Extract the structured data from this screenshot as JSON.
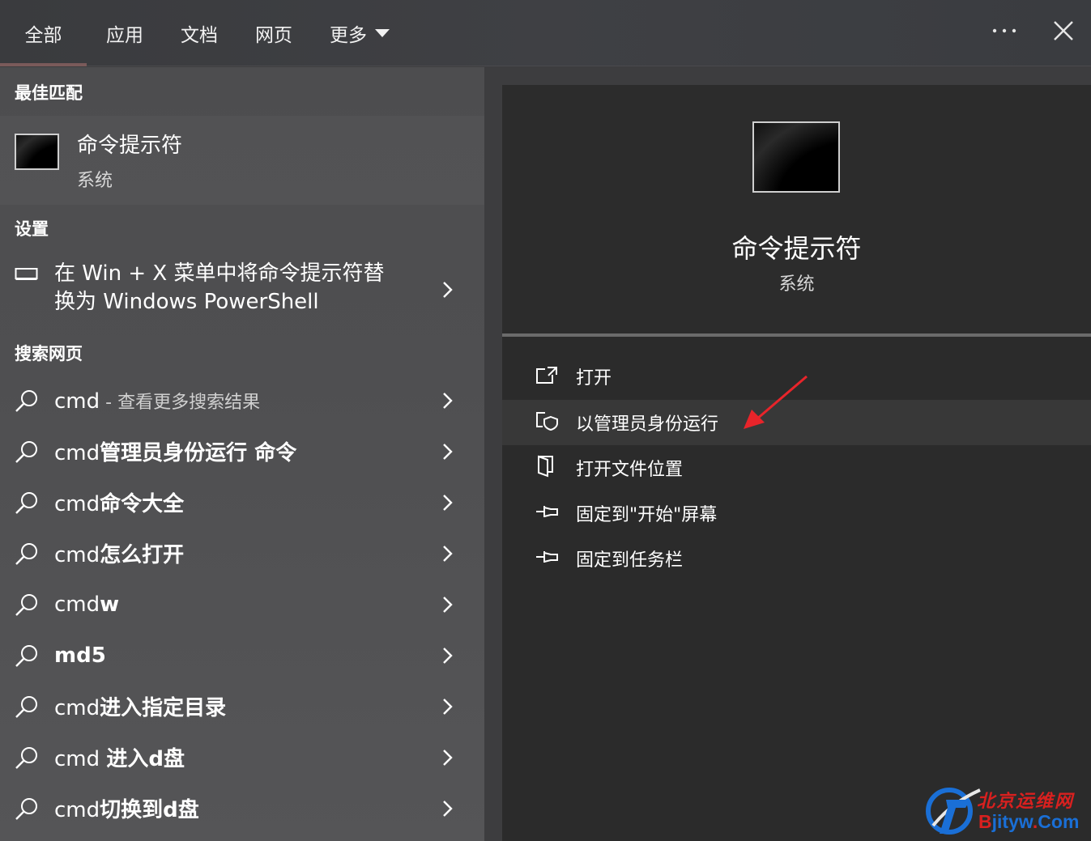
{
  "tabs": [
    {
      "label": "全部",
      "active": true
    },
    {
      "label": "应用"
    },
    {
      "label": "文档"
    },
    {
      "label": "网页"
    },
    {
      "label": "更多"
    }
  ],
  "top_icons": {
    "more": "more-horizontal-icon",
    "close": "close-icon"
  },
  "left": {
    "best_match_title": "最佳匹配",
    "best_match": {
      "name": "命令提示符",
      "subtitle": "系统",
      "icon": "command-prompt-icon"
    },
    "settings_title": "设置",
    "setting_item": {
      "line1": "在 Win + X 菜单中将命令提示符替",
      "line2": "换为 Windows PowerShell",
      "icon": "display-icon"
    },
    "web_title": "搜索网页",
    "web_items": [
      {
        "prefix": "cmd",
        "suffix": " - 查看更多搜索结果",
        "style": "muted"
      },
      {
        "prefix": "cmd",
        "suffix": "管理员身份运行 命令",
        "style": "bold"
      },
      {
        "prefix": "cmd",
        "suffix": "命令大全",
        "style": "bold"
      },
      {
        "prefix": "cmd",
        "suffix": "怎么打开",
        "style": "bold"
      },
      {
        "prefix": "cmd",
        "suffix": "w",
        "style": "bold"
      },
      {
        "prefix": "",
        "suffix": "md5",
        "style": "bold"
      },
      {
        "prefix": "cmd",
        "suffix": "进入指定目录",
        "style": "bold"
      },
      {
        "prefix": "cmd ",
        "suffix": "进入d盘",
        "style": "bold"
      },
      {
        "prefix": "cmd",
        "suffix": "切换到d盘",
        "style": "bold"
      }
    ]
  },
  "right": {
    "title": "命令提示符",
    "subtitle": "系统",
    "actions": [
      {
        "label": "打开",
        "icon": "open-window-icon"
      },
      {
        "label": "以管理员身份运行",
        "icon": "admin-shield-icon",
        "highlighted": true
      },
      {
        "label": "打开文件位置",
        "icon": "file-location-icon"
      },
      {
        "label": "固定到\"开始\"屏幕",
        "icon": "pin-icon"
      },
      {
        "label": "固定到任务栏",
        "icon": "pin-icon"
      }
    ]
  },
  "watermark": {
    "cn": "北京运维网",
    "en_b": "B",
    "en_rest": "jityw",
    "en_dot": ".",
    "en_com": "Com"
  },
  "colors": {
    "accent_arrow": "#e8242a",
    "watermark_red": "#d9201f",
    "watermark_blue": "#1a6fd6"
  }
}
